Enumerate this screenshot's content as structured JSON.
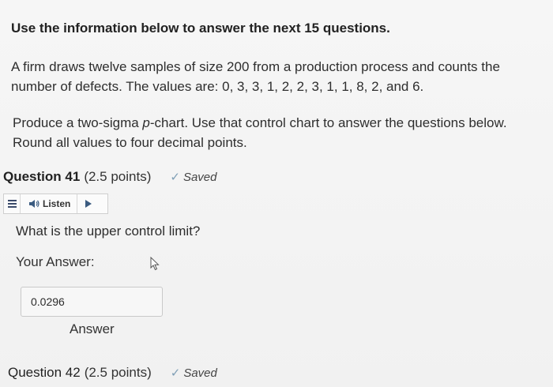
{
  "instructions": {
    "title": "Use the information below to answer the next 15 questions.",
    "paragraph1": "A firm draws twelve samples of size 200 from a production process and counts the number of defects. The values are: 0, 3, 3, 1, 2, 2, 3, 1, 1, 8, 2, and 6.",
    "paragraph2_pre": "Produce a two-sigma ",
    "paragraph2_italic": "p",
    "paragraph2_post": "-chart. Use that control chart to answer the questions below. Round all values to four decimal points."
  },
  "question41": {
    "title": "Question 41",
    "points": "(2.5 points)",
    "saved": "Saved",
    "listen_label": "Listen",
    "text": "What is the upper control limit?",
    "your_answer_label": "Your Answer:",
    "answer_value": "0.0296",
    "answer_field_label": "Answer"
  },
  "question42": {
    "title": "Question 42",
    "points": "(2.5 points)",
    "saved": "Saved"
  },
  "icons": {
    "check": "check-icon",
    "menu": "menu-icon",
    "speaker": "speaker-icon",
    "play": "play-icon",
    "cursor": "mouse-cursor-icon"
  }
}
